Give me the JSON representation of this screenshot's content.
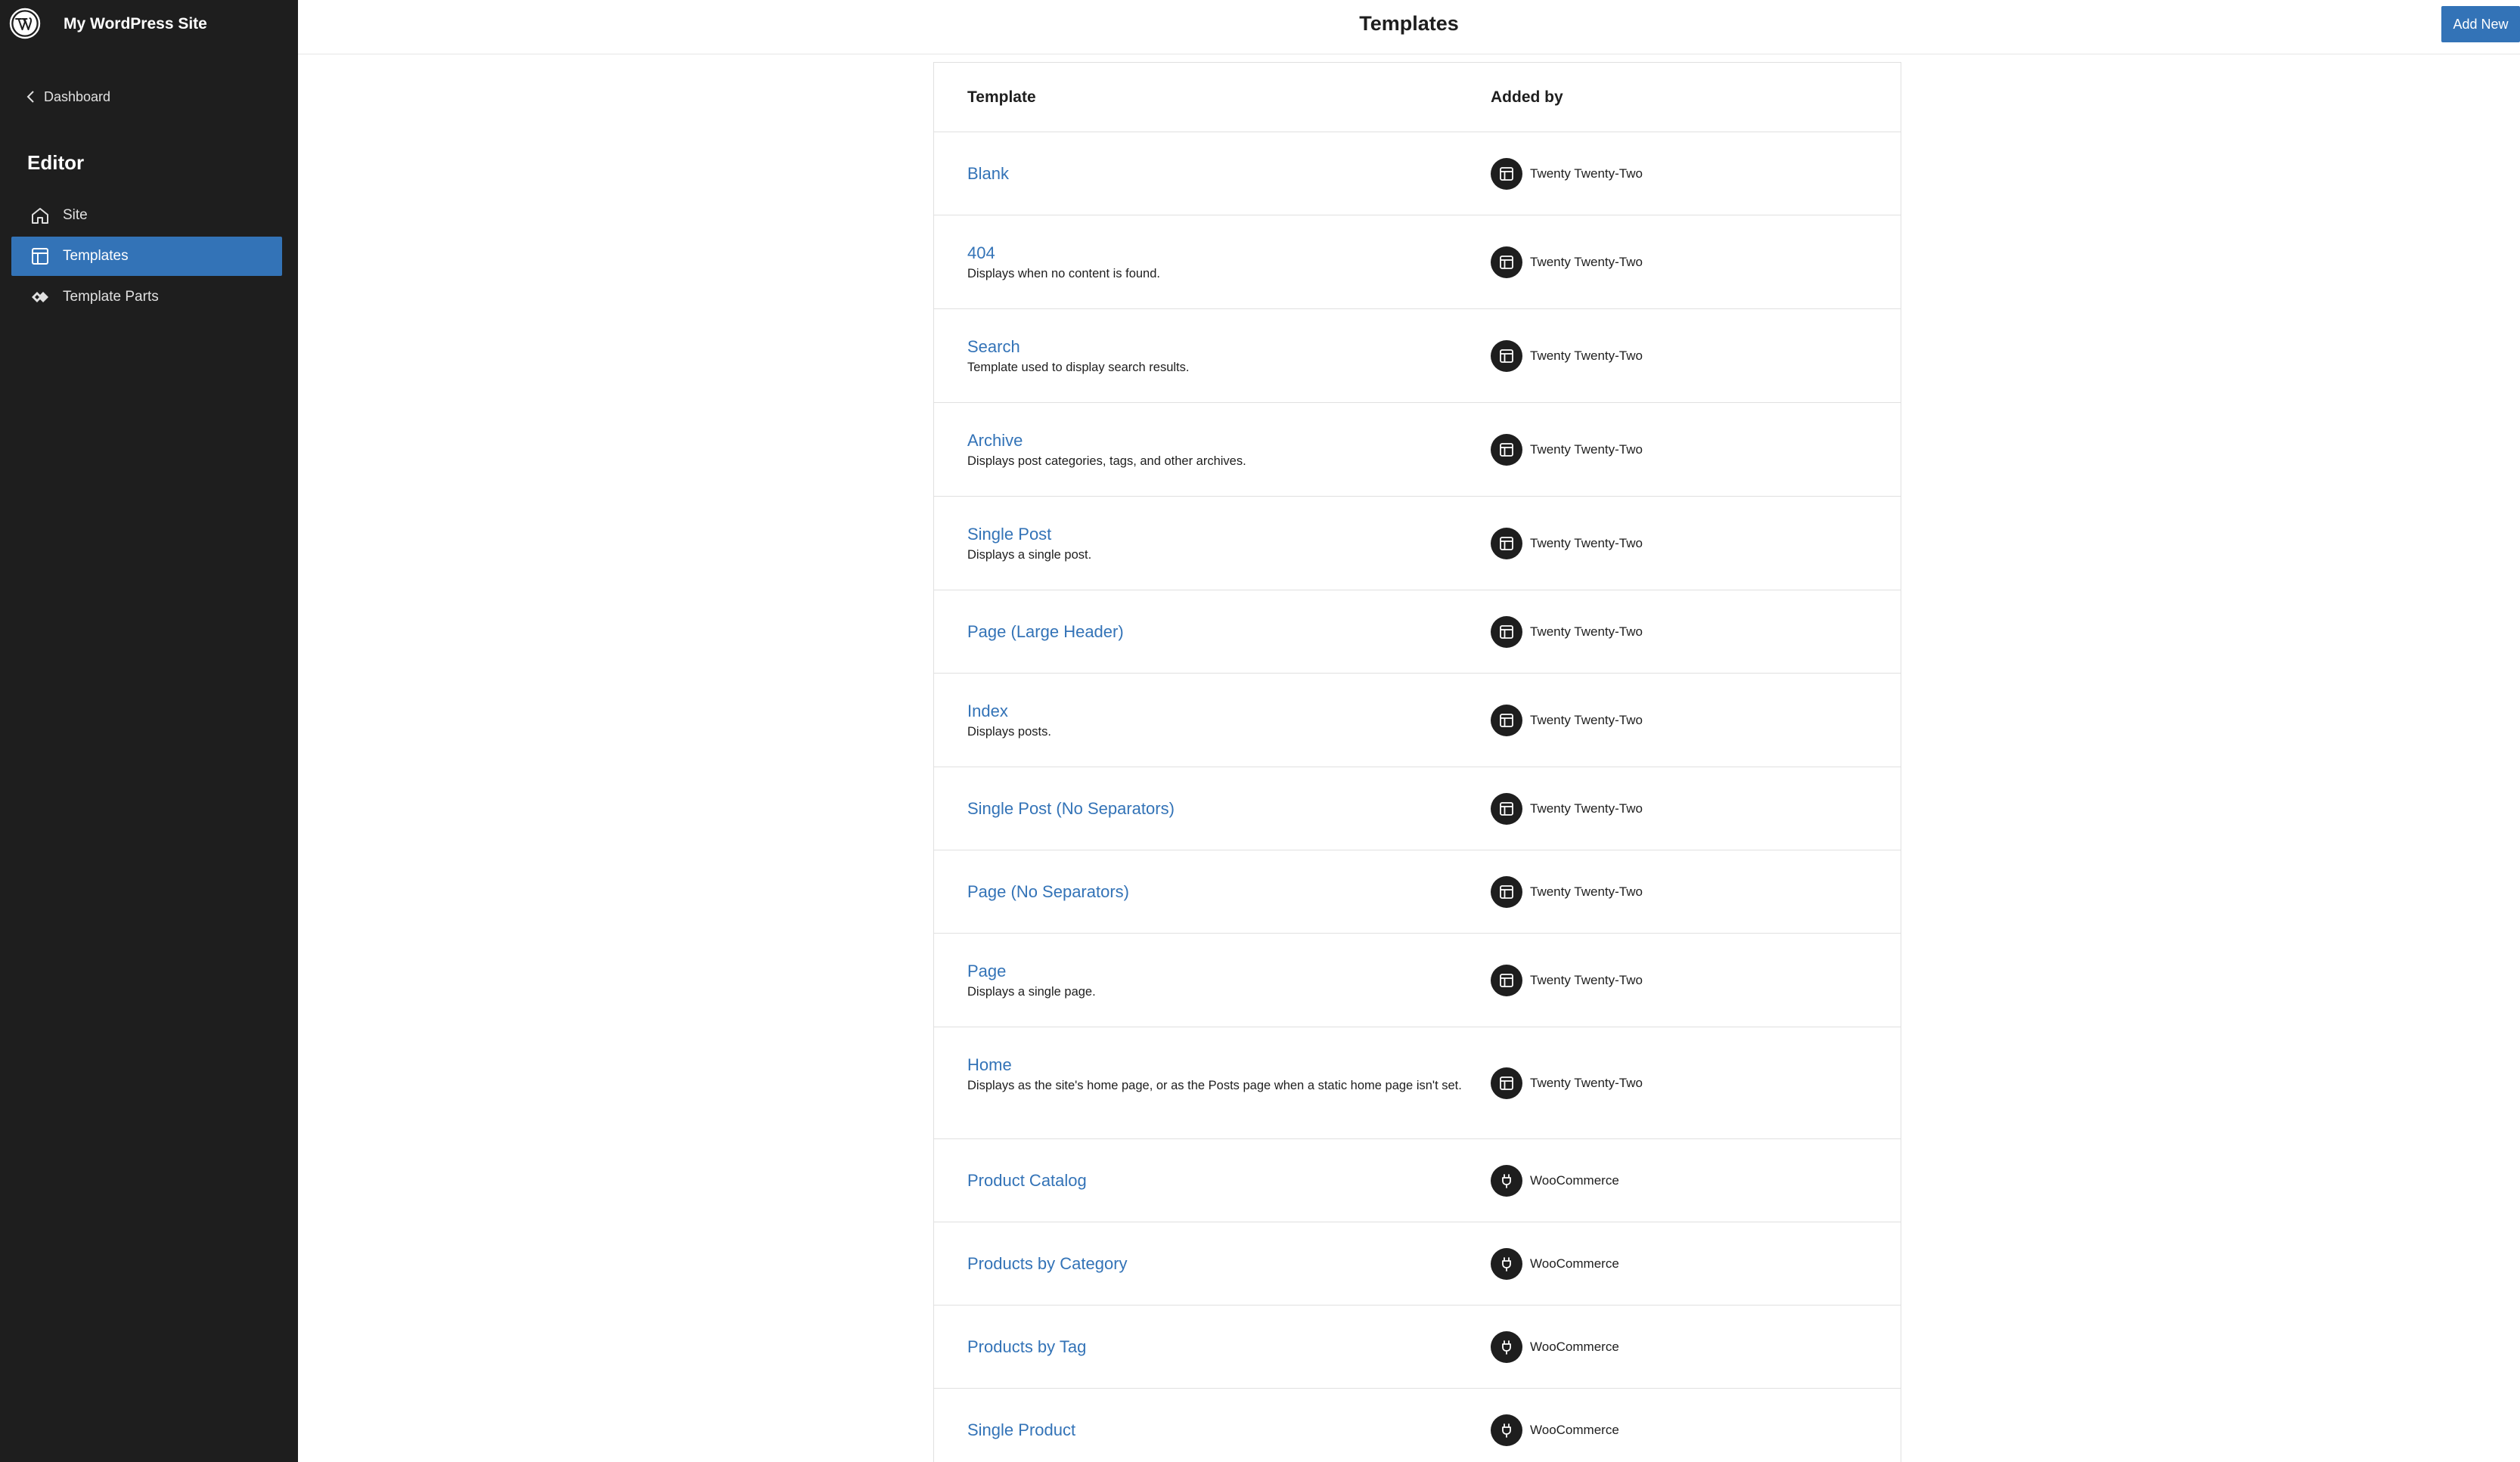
{
  "site": {
    "title": "My WordPress Site"
  },
  "sidebar": {
    "back_label": "Dashboard",
    "heading": "Editor",
    "items": [
      {
        "label": "Site",
        "icon": "home-icon",
        "active": false
      },
      {
        "label": "Templates",
        "icon": "layout-icon",
        "active": true
      },
      {
        "label": "Template Parts",
        "icon": "symbol-filled-icon",
        "active": false
      }
    ]
  },
  "header": {
    "title": "Templates",
    "add_new_label": "Add New"
  },
  "table": {
    "columns": [
      "Template",
      "Added by"
    ],
    "rows": [
      {
        "title": "Blank",
        "description": "",
        "added_by": "Twenty Twenty-Two",
        "source_icon": "layout-icon"
      },
      {
        "title": "404",
        "description": "Displays when no content is found.",
        "added_by": "Twenty Twenty-Two",
        "source_icon": "layout-icon"
      },
      {
        "title": "Search",
        "description": "Template used to display search results.",
        "added_by": "Twenty Twenty-Two",
        "source_icon": "layout-icon"
      },
      {
        "title": "Archive",
        "description": "Displays post categories, tags, and other archives.",
        "added_by": "Twenty Twenty-Two",
        "source_icon": "layout-icon"
      },
      {
        "title": "Single Post",
        "description": "Displays a single post.",
        "added_by": "Twenty Twenty-Two",
        "source_icon": "layout-icon"
      },
      {
        "title": "Page (Large Header)",
        "description": "",
        "added_by": "Twenty Twenty-Two",
        "source_icon": "layout-icon"
      },
      {
        "title": "Index",
        "description": "Displays posts.",
        "added_by": "Twenty Twenty-Two",
        "source_icon": "layout-icon"
      },
      {
        "title": "Single Post (No Separators)",
        "description": "",
        "added_by": "Twenty Twenty-Two",
        "source_icon": "layout-icon"
      },
      {
        "title": "Page (No Separators)",
        "description": "",
        "added_by": "Twenty Twenty-Two",
        "source_icon": "layout-icon"
      },
      {
        "title": "Page",
        "description": "Displays a single page.",
        "added_by": "Twenty Twenty-Two",
        "source_icon": "layout-icon"
      },
      {
        "title": "Home",
        "description": "Displays as the site's home page, or as the Posts page when a static home page isn't set.",
        "added_by": "Twenty Twenty-Two",
        "source_icon": "layout-icon"
      },
      {
        "title": "Product Catalog",
        "description": "",
        "added_by": "WooCommerce",
        "source_icon": "plugin-icon"
      },
      {
        "title": "Products by Category",
        "description": "",
        "added_by": "WooCommerce",
        "source_icon": "plugin-icon"
      },
      {
        "title": "Products by Tag",
        "description": "",
        "added_by": "WooCommerce",
        "source_icon": "plugin-icon"
      },
      {
        "title": "Single Product",
        "description": "",
        "added_by": "WooCommerce",
        "source_icon": "plugin-icon"
      }
    ]
  },
  "colors": {
    "sidebar_bg": "#1e1e1e",
    "accent": "#3373b7",
    "text": "#1e1e1e"
  }
}
